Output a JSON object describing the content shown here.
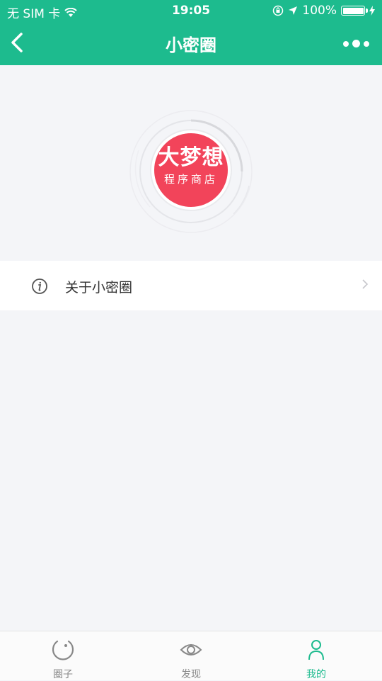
{
  "status_bar": {
    "carrier": "无 SIM 卡",
    "time": "19:05",
    "battery": "100%"
  },
  "nav": {
    "title": "小密圈"
  },
  "logo": {
    "line1": "大梦想",
    "line2": "程序商店"
  },
  "menu": {
    "items": [
      {
        "label": "关于小密圈"
      }
    ]
  },
  "tabbar": {
    "tabs": [
      {
        "label": "圈子"
      },
      {
        "label": "发现"
      },
      {
        "label": "我的"
      }
    ]
  },
  "colors": {
    "brand": "#1dbb8e",
    "logo": "#f2445a"
  }
}
